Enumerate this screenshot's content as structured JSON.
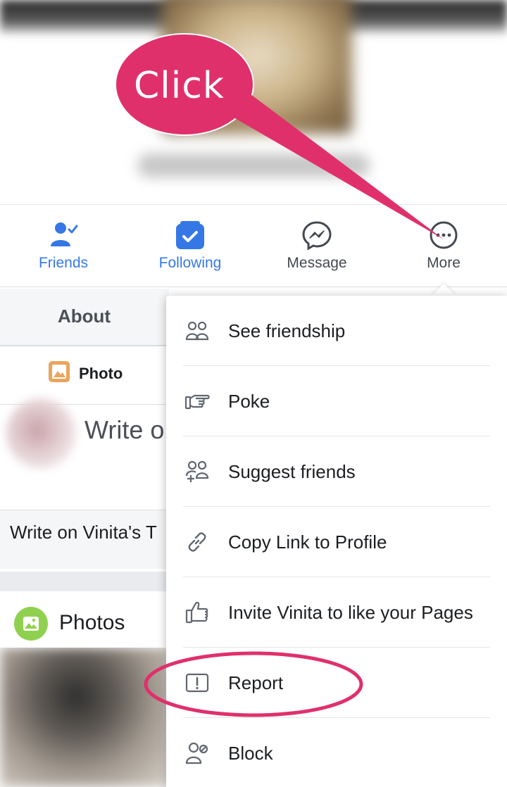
{
  "actions": [
    {
      "label": "Friends",
      "icon": "friends-check-icon",
      "active": true
    },
    {
      "label": "Following",
      "icon": "following-check-icon",
      "active": true
    },
    {
      "label": "Message",
      "icon": "messenger-icon",
      "active": false
    },
    {
      "label": "More",
      "icon": "more-dots-icon",
      "active": false
    }
  ],
  "profile": {
    "tab_about": "About",
    "photo_chip": "Photo",
    "composer_placeholder": "Write o",
    "timeline_prompt": "Write on Vinita's T",
    "photos_title": "Photos"
  },
  "menu": {
    "items": [
      {
        "label": "See friendship",
        "icon": "friendship-icon"
      },
      {
        "label": "Poke",
        "icon": "poke-hand-icon"
      },
      {
        "label": "Suggest friends",
        "icon": "suggest-friends-icon"
      },
      {
        "label": "Copy Link to Profile",
        "icon": "link-icon"
      },
      {
        "label": "Invite Vinita to like your Pages",
        "icon": "thumbs-up-icon"
      },
      {
        "label": "Report",
        "icon": "report-icon"
      },
      {
        "label": "Block",
        "icon": "block-user-icon"
      }
    ]
  },
  "annotation": {
    "callout_text": "Click",
    "callout_color": "#e0306b",
    "highlight_color": "#e0306b"
  },
  "colors": {
    "accent_blue": "#3578e5",
    "icon_gray": "#606770",
    "text_dark": "#1c1e21"
  }
}
